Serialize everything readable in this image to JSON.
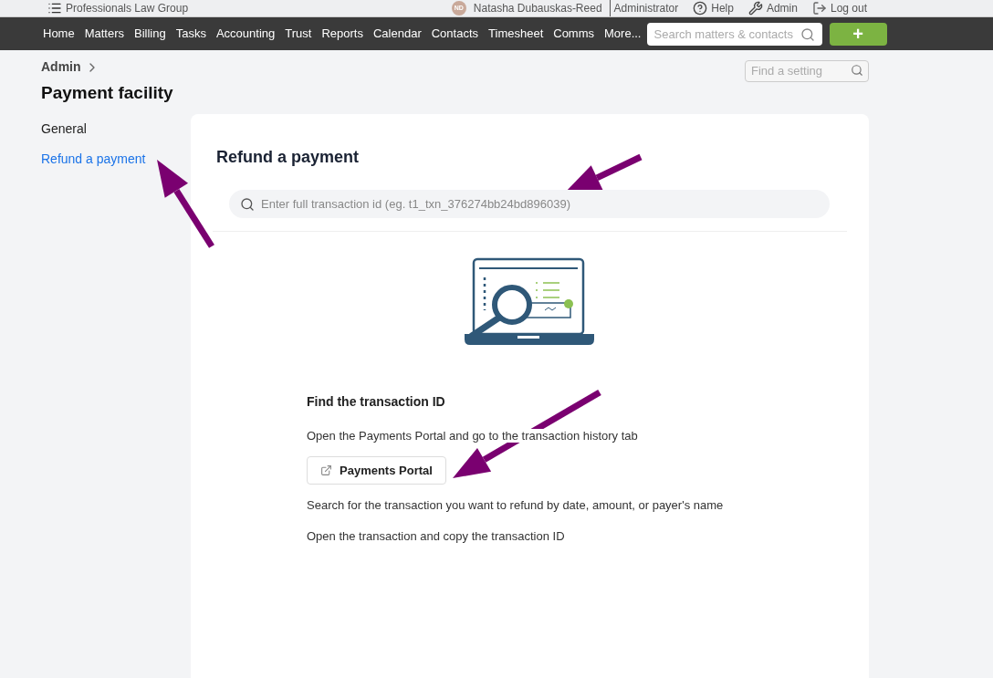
{
  "top_bar": {
    "firm": "Professionals Law Group",
    "avatar": "ND",
    "user": "Natasha Dubauskas-Reed",
    "role": "Administrator",
    "links": [
      {
        "label": "Help",
        "kind": "help"
      },
      {
        "label": "Admin",
        "kind": "admin"
      },
      {
        "label": "Log out",
        "kind": "logout"
      }
    ]
  },
  "nav": {
    "items": [
      {
        "label": "Home"
      },
      {
        "label": "Matters"
      },
      {
        "label": "Billing"
      },
      {
        "label": "Tasks"
      },
      {
        "label": "Accounting"
      },
      {
        "label": "Trust"
      },
      {
        "label": "Reports"
      },
      {
        "label": "Calendar"
      },
      {
        "label": "Contacts"
      },
      {
        "label": "Timesheet"
      },
      {
        "label": "Comms"
      },
      {
        "label": "More..."
      }
    ],
    "search": {
      "placeholder": "Search matters & contacts"
    },
    "add_button": "+"
  },
  "breadcrumb": "Admin",
  "page_title": "Payment facility",
  "setting_search": {
    "placeholder": "Find a setting"
  },
  "sidebar": {
    "items": [
      {
        "label": "General",
        "selected": false
      },
      {
        "label": "Refund a payment",
        "selected": true
      }
    ]
  },
  "panel": {
    "title": "Refund a payment",
    "search": {
      "placeholder": "Enter full transaction id (eg. t1_txn_376274bb24bd896039)"
    },
    "heading": "Find the transaction ID",
    "steps": [
      {
        "kind": "text",
        "text": "Open the Payments Portal and go to the transaction history tab"
      },
      {
        "kind": "button",
        "text": "Payments Portal"
      },
      {
        "kind": "text",
        "text": "Search for the transaction you want to refund by date, amount, or payer's name"
      },
      {
        "kind": "text",
        "text": "Open the transaction and copy the transaction ID"
      }
    ]
  }
}
